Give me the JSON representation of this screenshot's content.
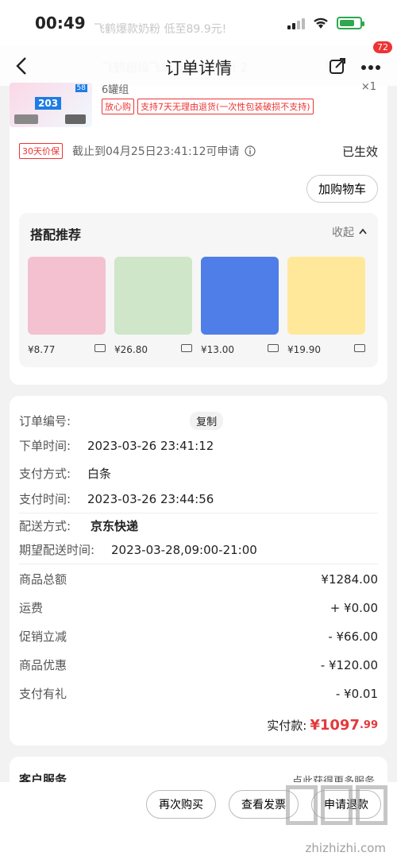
{
  "status": {
    "time": "00:49"
  },
  "ghost": {
    "promo": "飞鹤爆款奶粉 低至89.9元!",
    "line2": "飞鹤超级飞帆 婴儿方奶粉 2",
    "line3": "¥"
  },
  "nav": {
    "title": "订单详情",
    "badge": "72"
  },
  "product": {
    "spec": "6罐组",
    "qty": "×1",
    "thumb_big": "203",
    "thumb_small": "58",
    "tag1": "放心购",
    "tag2": "支持7天无理由退货(一次性包装破损不支持)"
  },
  "protect": {
    "tag": "30天价保",
    "text": "截止到04月25日23:41:12可申请",
    "status": "已生效",
    "add_cart": "加购物车"
  },
  "reco": {
    "title": "搭配推荐",
    "collapse": "收起",
    "items": [
      {
        "price": "¥8.77",
        "color": "#f3c1cf"
      },
      {
        "price": "¥26.80",
        "color": "#cfe6c8"
      },
      {
        "price": "¥13.00",
        "color": "#4f7ee8"
      },
      {
        "price": "¥19.90",
        "color": "#ffe89a"
      }
    ]
  },
  "order": {
    "id_label": "订单编号:",
    "copy": "复制",
    "time_label": "下单时间:",
    "time_value": "2023-03-26 23:41:12",
    "pay_label": "支付方式:",
    "pay_value": "白条",
    "paytime_label": "支付时间:",
    "paytime_value": "2023-03-26 23:44:56",
    "ship_label": "配送方式:",
    "ship_value": "京东快递",
    "expect_label": "期望配送时间:",
    "expect_value": "2023-03-28,09:00-21:00"
  },
  "amounts": {
    "items": [
      {
        "label": "商品总额",
        "value": "¥1284.00"
      },
      {
        "label": "运费",
        "value": "+ ¥0.00"
      },
      {
        "label": "促销立减",
        "value": "- ¥66.00"
      },
      {
        "label": "商品优惠",
        "value": "- ¥120.00"
      },
      {
        "label": "支付有礼",
        "value": "- ¥0.01"
      }
    ],
    "paid_label": "实付款:",
    "paid_main": "¥1097",
    "paid_cents": ".99"
  },
  "service": {
    "title": "客户服务",
    "link": "点此获得更多服务"
  },
  "bottom": {
    "rebuy": "再次购买",
    "invoice": "查看发票",
    "refund": "申请退款",
    "watermark": "zhizhizhi.com"
  },
  "colors": {
    "accent": "#e4393c"
  }
}
